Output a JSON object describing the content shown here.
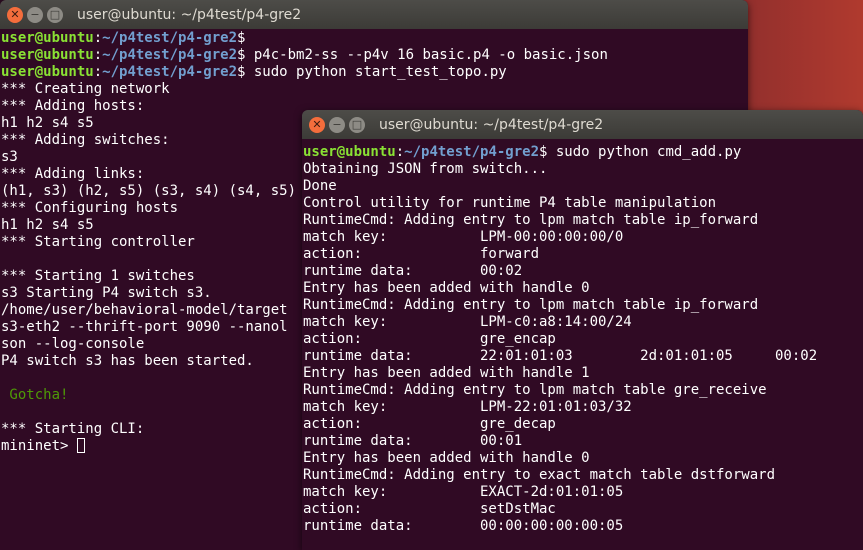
{
  "window1": {
    "title": "user@ubuntu: ~/p4test/p4-gre2",
    "lines": [
      {
        "user": "user@ubuntu",
        "sep": ":",
        "path": "~/p4test/p4-gre2",
        "cmd": "$"
      },
      {
        "user": "user@ubuntu",
        "sep": ":",
        "path": "~/p4test/p4-gre2",
        "cmd": "$ p4c-bm2-ss --p4v 16 basic.p4 -o basic.json"
      },
      {
        "user": "user@ubuntu",
        "sep": ":",
        "path": "~/p4test/p4-gre2",
        "cmd": "$ sudo python start_test_topo.py"
      },
      {
        "text": "*** Creating network"
      },
      {
        "text": "*** Adding hosts:"
      },
      {
        "text": "h1 h2 s4 s5"
      },
      {
        "text": "*** Adding switches:"
      },
      {
        "text": "s3"
      },
      {
        "text": "*** Adding links:"
      },
      {
        "text": "(h1, s3) (h2, s5) (s3, s4) (s4, s5)"
      },
      {
        "text": "*** Configuring hosts"
      },
      {
        "text": "h1 h2 s4 s5"
      },
      {
        "text": "*** Starting controller"
      },
      {
        "text": ""
      },
      {
        "text": "*** Starting 1 switches"
      },
      {
        "text": "s3 Starting P4 switch s3."
      },
      {
        "text": "/home/user/behavioral-model/target"
      },
      {
        "text": "s3-eth2 --thrift-port 9090 --nanol"
      },
      {
        "text": "son --log-console"
      },
      {
        "text": "P4 switch s3 has been started."
      },
      {
        "text": ""
      },
      {
        "green": " Gotcha!"
      },
      {
        "text": ""
      },
      {
        "text": "*** Starting CLI:"
      },
      {
        "text": "mininet> ",
        "cursor": true
      }
    ]
  },
  "window2": {
    "title": "user@ubuntu: ~/p4test/p4-gre2",
    "lines": [
      {
        "user": "user@ubuntu",
        "sep": ":",
        "path": "~/p4test/p4-gre2",
        "cmd": "$ sudo python cmd_add.py"
      },
      {
        "text": "Obtaining JSON from switch..."
      },
      {
        "text": "Done"
      },
      {
        "text": "Control utility for runtime P4 table manipulation"
      },
      {
        "text": "RuntimeCmd: Adding entry to lpm match table ip_forward"
      },
      {
        "text": "match key:           LPM-00:00:00:00/0"
      },
      {
        "text": "action:              forward"
      },
      {
        "text": "runtime data:        00:02"
      },
      {
        "text": "Entry has been added with handle 0"
      },
      {
        "text": "RuntimeCmd: Adding entry to lpm match table ip_forward"
      },
      {
        "text": "match key:           LPM-c0:a8:14:00/24"
      },
      {
        "text": "action:              gre_encap"
      },
      {
        "text": "runtime data:        22:01:01:03        2d:01:01:05     00:02"
      },
      {
        "text": "Entry has been added with handle 1"
      },
      {
        "text": "RuntimeCmd: Adding entry to lpm match table gre_receive"
      },
      {
        "text": "match key:           LPM-22:01:01:03/32"
      },
      {
        "text": "action:              gre_decap"
      },
      {
        "text": "runtime data:        00:01"
      },
      {
        "text": "Entry has been added with handle 0"
      },
      {
        "text": "RuntimeCmd: Adding entry to exact match table dstforward"
      },
      {
        "text": "match key:           EXACT-2d:01:01:05"
      },
      {
        "text": "action:              setDstMac"
      },
      {
        "text": "runtime data:        00:00:00:00:00:05"
      }
    ]
  },
  "colors": {
    "terminal_bg": "#300a24",
    "prompt_user": "#8ae234",
    "prompt_path": "#729fcf",
    "gotcha_text": "#4e9a06"
  },
  "icons": {
    "close": "close-icon",
    "minimize": "minimize-icon",
    "maximize": "maximize-icon"
  }
}
